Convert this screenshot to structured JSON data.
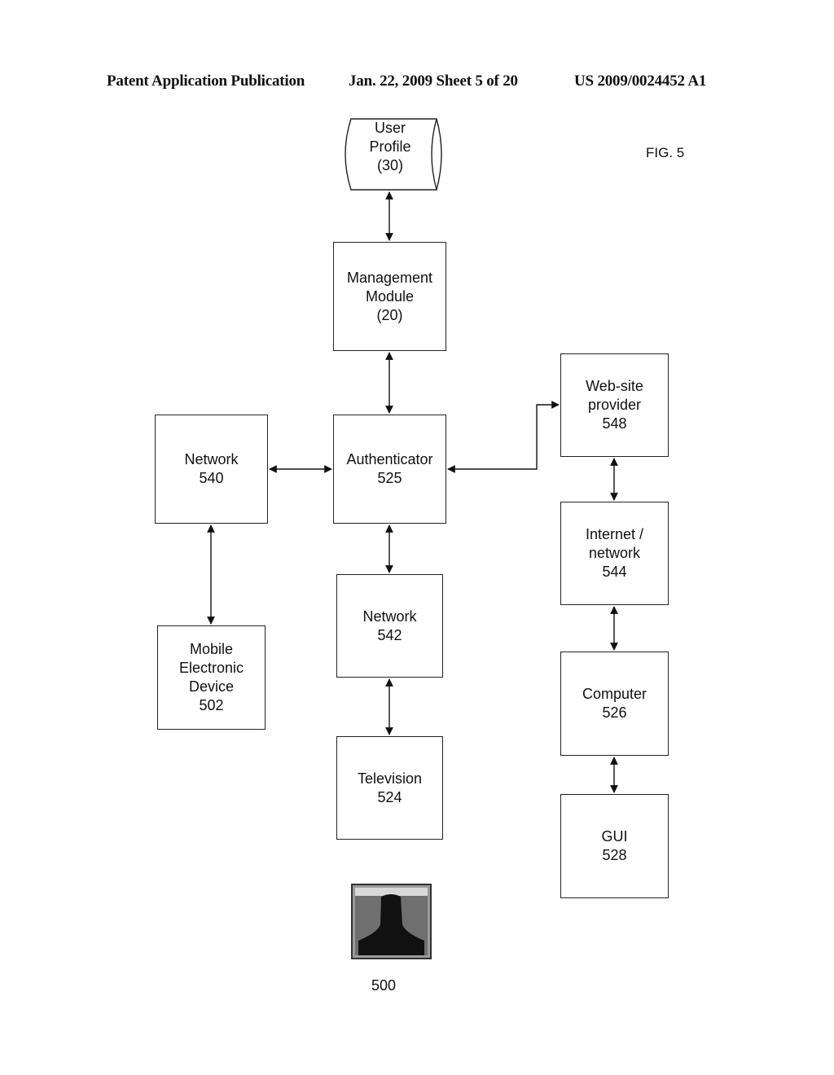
{
  "header": {
    "left": "Patent Application Publication",
    "center": "Jan. 22, 2009  Sheet 5 of 20",
    "right": "US 2009/0024452 A1"
  },
  "figure_label": "FIG. 5",
  "nodes": {
    "user_profile": "User\nProfile\n(30)",
    "management_module": "Management\nModule\n(20)",
    "authenticator": "Authenticator\n525",
    "network_540": "Network\n540",
    "mobile_device": "Mobile\nElectronic\nDevice\n502",
    "network_542": "Network\n542",
    "television": "Television\n524",
    "website_provider": "Web-site\nprovider\n548",
    "internet_network": "Internet /\nnetwork\n544",
    "computer": "Computer\n526",
    "gui": "GUI\n528"
  },
  "user_reference": "500",
  "connections": [
    [
      "user_profile",
      "management_module"
    ],
    [
      "management_module",
      "authenticator"
    ],
    [
      "network_540",
      "authenticator"
    ],
    [
      "authenticator",
      "website_provider"
    ],
    [
      "network_540",
      "mobile_device"
    ],
    [
      "authenticator",
      "network_542"
    ],
    [
      "network_542",
      "television"
    ],
    [
      "website_provider",
      "internet_network"
    ],
    [
      "internet_network",
      "computer"
    ],
    [
      "computer",
      "gui"
    ]
  ]
}
